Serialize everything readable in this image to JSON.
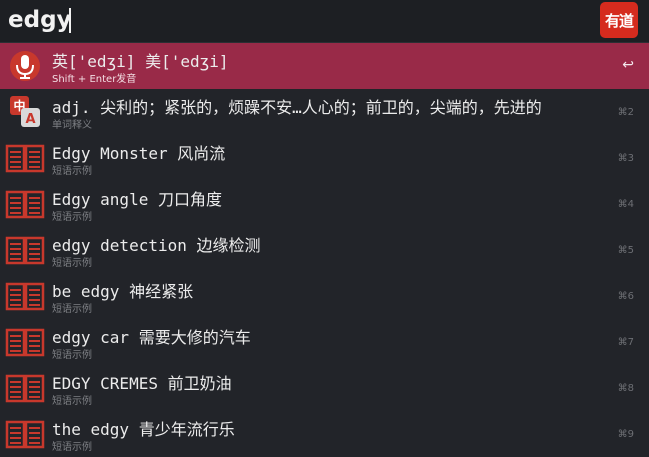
{
  "search": {
    "query": "edgy"
  },
  "logo": {
    "text": "有道"
  },
  "results": [
    {
      "title": "英['edʒi]  美['edʒi]",
      "subtitle": "Shift + Enter发音",
      "shortcut": "↩",
      "icon": "microphone-icon"
    },
    {
      "title": "adj. 尖利的；紧张的，烦躁不安…人心的；前卫的，尖端的，先进的",
      "subtitle": "单词释义",
      "shortcut": "⌘2",
      "icon": "translate-icon"
    },
    {
      "title": "Edgy Monster 风尚流",
      "subtitle": "短语示例",
      "shortcut": "⌘3",
      "icon": "book-icon"
    },
    {
      "title": "Edgy angle 刀口角度",
      "subtitle": "短语示例",
      "shortcut": "⌘4",
      "icon": "book-icon"
    },
    {
      "title": "edgy detection 边缘检测",
      "subtitle": "短语示例",
      "shortcut": "⌘5",
      "icon": "book-icon"
    },
    {
      "title": "be edgy 神经紧张",
      "subtitle": "短语示例",
      "shortcut": "⌘6",
      "icon": "book-icon"
    },
    {
      "title": "edgy car 需要大修的汽车",
      "subtitle": "短语示例",
      "shortcut": "⌘7",
      "icon": "book-icon"
    },
    {
      "title": "EDGY CREMES 前卫奶油",
      "subtitle": "短语示例",
      "shortcut": "⌘8",
      "icon": "book-icon"
    },
    {
      "title": "the edgy 青少年流行乐",
      "subtitle": "短语示例",
      "shortcut": "⌘9",
      "icon": "book-icon"
    }
  ],
  "colors": {
    "accent": "#992a48",
    "brand": "#d52b1e",
    "icon": "#c8382c"
  }
}
